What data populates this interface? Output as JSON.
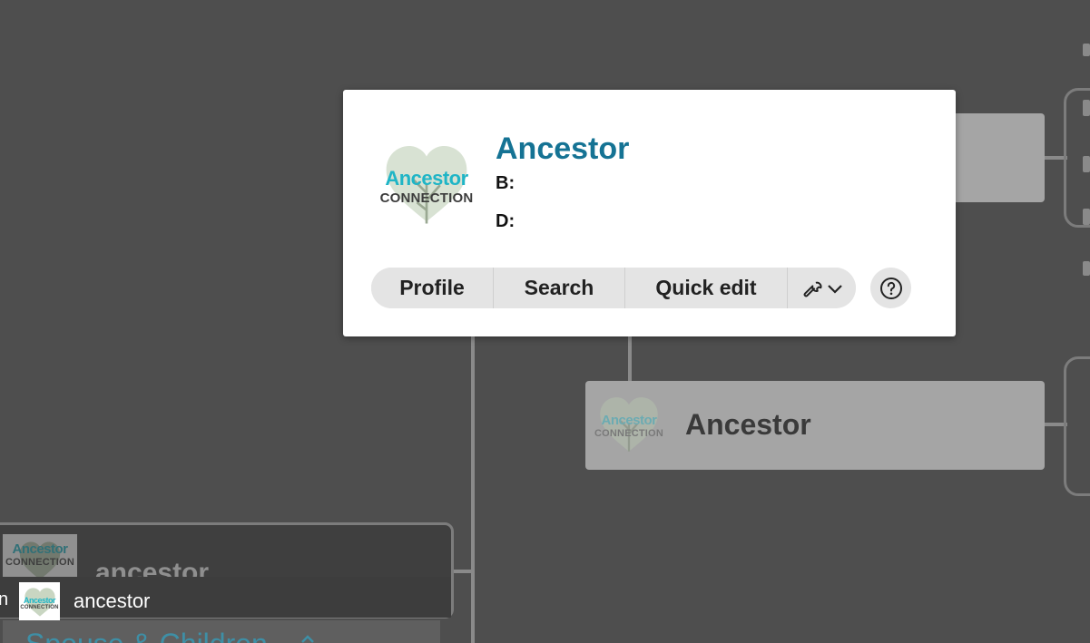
{
  "popup": {
    "name": "Ancestor",
    "birth_label": "B:",
    "death_label": "D:",
    "logo": {
      "line1": "Ancestor",
      "line2": "CONNECTION"
    },
    "buttons": {
      "profile": "Profile",
      "search": "Search",
      "quick_edit": "Quick edit"
    },
    "tools_icon": "wrench-icon",
    "help_icon": "question-circle-icon"
  },
  "cards": {
    "right_card": {
      "name": "Ancestor",
      "logo": {
        "line1": "Ancestor",
        "line2": "CONNECTION"
      }
    },
    "left_card": {
      "name": "ancestor",
      "logo": {
        "line1": "Ancestor",
        "line2": "CONNECTION"
      }
    }
  },
  "bottom_bar": {
    "leading_char": "n",
    "name": "ancestor",
    "logo": {
      "line1": "Ancestor",
      "line2": "CONNECTION"
    }
  },
  "section_header": {
    "label": "Spouse & Children",
    "toggle_icon": "chevron-up-icon"
  },
  "colors": {
    "background": "#4e4e4e",
    "accent_name": "#157394",
    "logo_teal": "#1fb5c6",
    "card_bg": "#a5a5a5",
    "button_bg": "#e4e4e4"
  }
}
